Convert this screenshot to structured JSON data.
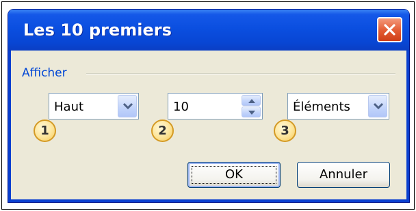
{
  "dialog": {
    "title": "Les 10 premiers",
    "group_label": "Afficher",
    "combo_direction": {
      "value": "Haut",
      "badge": "1"
    },
    "spin_count": {
      "value": "10",
      "badge": "2"
    },
    "combo_type": {
      "value": "Éléments",
      "badge": "3"
    },
    "ok_label": "OK",
    "cancel_label": "Annuler"
  },
  "colors": {
    "title_bar": "#0b4fe0",
    "close_button": "#e35a32",
    "client_background": "#ece9d8",
    "group_label": "#0046d5",
    "badge": "#fde59a"
  },
  "icons": [
    "close-icon",
    "chevron-down-icon",
    "spin-up-icon",
    "spin-down-icon"
  ]
}
